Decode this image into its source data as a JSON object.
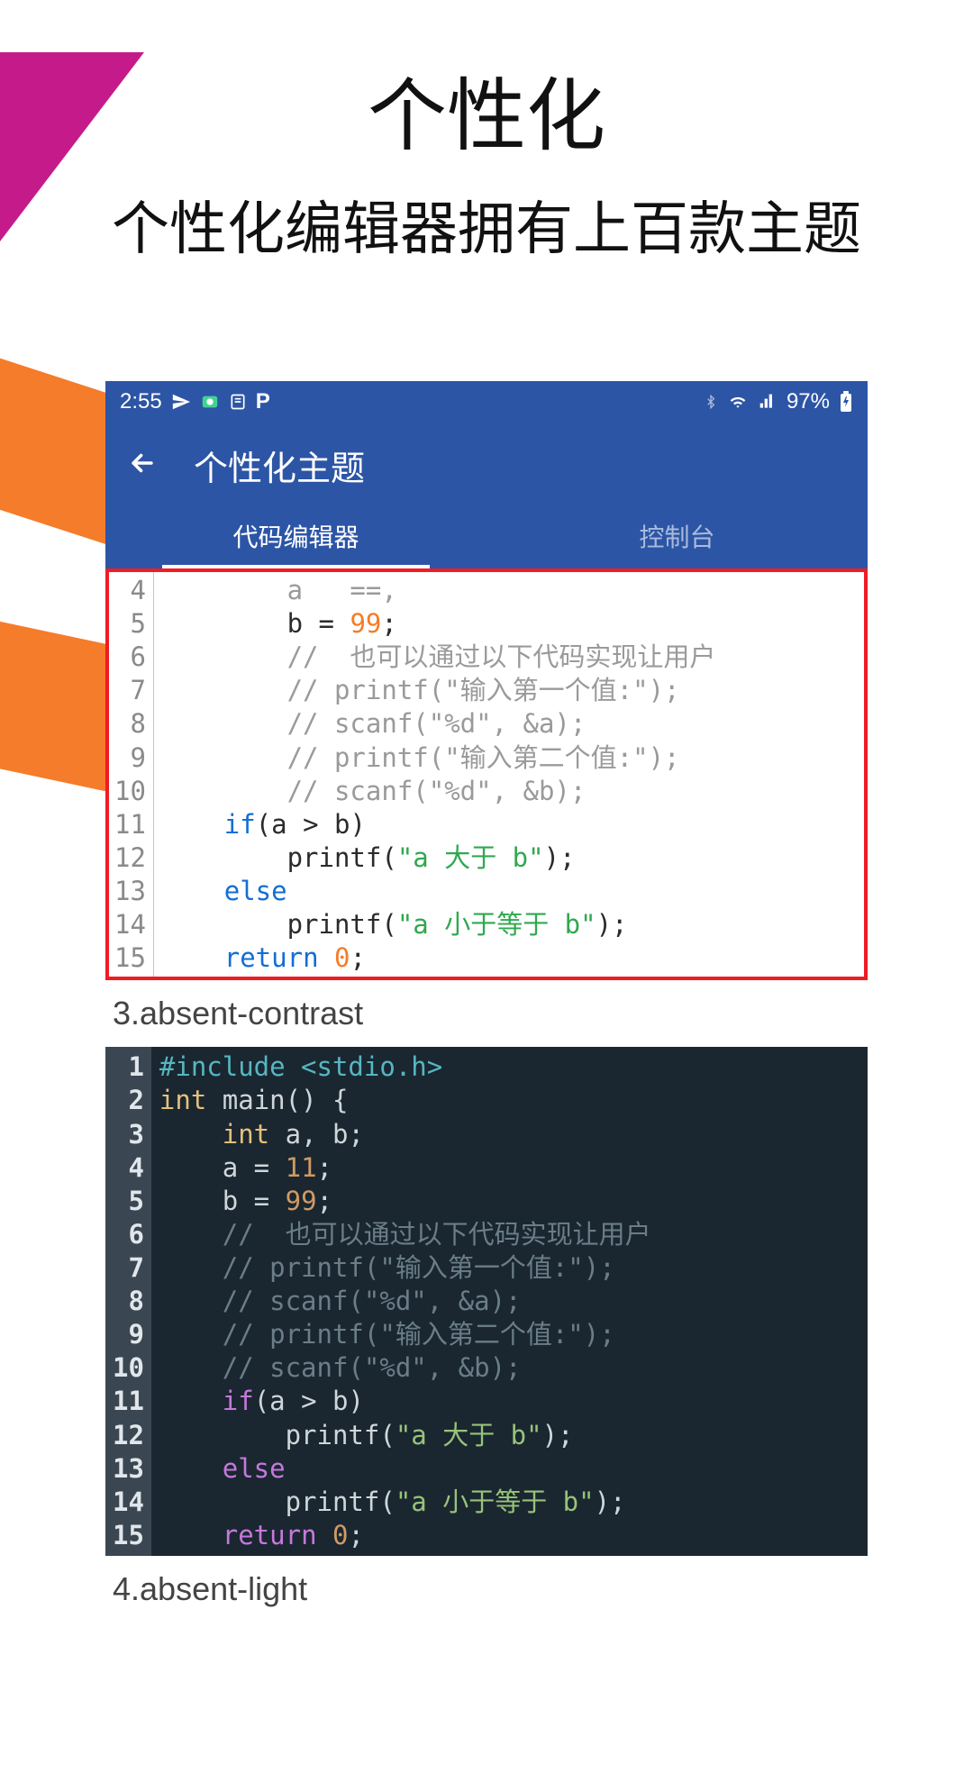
{
  "page": {
    "title": "个性化",
    "subtitle": "个性化编辑器拥有上百款主题"
  },
  "status_bar": {
    "time": "2:55",
    "battery_text": "97%"
  },
  "toolbar": {
    "title": "个性化主题"
  },
  "tabs": {
    "editor": "代码编辑器",
    "console": "控制台"
  },
  "light_preview": {
    "gutter": "4\n5\n6\n7\n8\n9\n10\n11\n12\n13\n14\n15",
    "line4": "        a   ==,",
    "line5_a": "        b = ",
    "line5_num": "99",
    "line5_b": ";",
    "line6": "        //  也可以通过以下代码实现让用户",
    "line7": "        // printf(\"输入第一个值:\");",
    "line8": "        // scanf(\"%d\", &a);",
    "line9": "        // printf(\"输入第二个值:\");",
    "line10": "        // scanf(\"%d\", &b);",
    "line11_a": "    ",
    "line11_kw": "if",
    "line11_b": "(a > b)",
    "line12_a": "        printf(",
    "line12_str": "\"a 大于 b\"",
    "line12_b": ");",
    "line13_a": "    ",
    "line13_kw": "else",
    "line14_a": "        printf(",
    "line14_str": "\"a 小于等于 b\"",
    "line14_b": ");",
    "line15_a": "    ",
    "line15_kw": "return",
    "line15_sp": " ",
    "line15_num": "0",
    "line15_b": ";"
  },
  "theme_labels": {
    "t3": "3.absent-contrast",
    "t4": "4.absent-light"
  },
  "dark_preview": {
    "gutter": "1\n2\n3\n4\n5\n6\n7\n8\n9\n10\n11\n12\n13\n14\n15",
    "line1": "#include <stdio.h>",
    "line2_a": "int",
    "line2_b": " main() {",
    "line3_a": "    ",
    "line3_kw": "int",
    "line3_b": " a, b;",
    "line4_a": "    a = ",
    "line4_num": "11",
    "line4_b": ";",
    "line5_a": "    b = ",
    "line5_num": "99",
    "line5_b": ";",
    "line6": "    //  也可以通过以下代码实现让用户",
    "line7": "    // printf(\"输入第一个值:\");",
    "line8": "    // scanf(\"%d\", &a);",
    "line9": "    // printf(\"输入第二个值:\");",
    "line10": "    // scanf(\"%d\", &b);",
    "line11_a": "    ",
    "line11_kw": "if",
    "line11_b": "(a > b)",
    "line12_a": "        printf(",
    "line12_str": "\"a 大于 b\"",
    "line12_b": ");",
    "line13_a": "    ",
    "line13_kw": "else",
    "line14_a": "        printf(",
    "line14_str": "\"a 小于等于 b\"",
    "line14_b": ");",
    "line15_a": "    ",
    "line15_kw": "return",
    "line15_sp": " ",
    "line15_num": "0",
    "line15_b": ";"
  }
}
